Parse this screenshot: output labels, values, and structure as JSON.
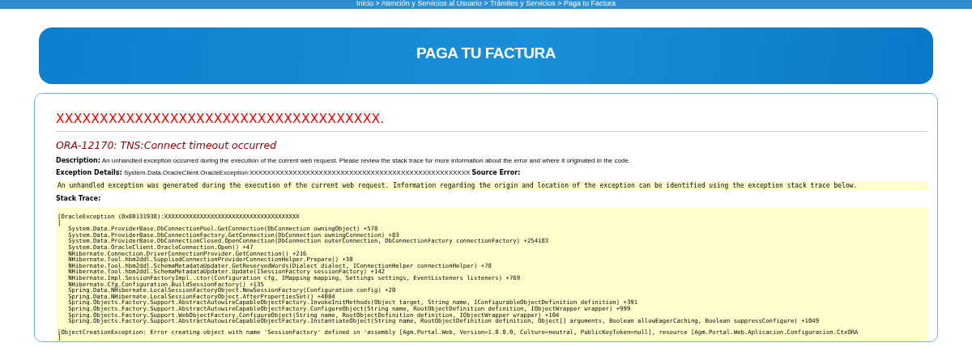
{
  "breadcrumb": "Inicio > Atención y Servicios al Usuario > Trámites y Servicios > Paga tu Factura",
  "banner": {
    "title": "PAGA TU FACTURA"
  },
  "error": {
    "heading": "XXXXXXXXXXXXXXXXXXXXXXXXXXXXXXXXXXXXX.",
    "subheading": "ORA-12170: TNS:Connect timeout occurred",
    "description": "**Description:** An unhandled exception occurred during the execution of the current web request. Please review the stack trace for more information about the error and where it originated in the code.",
    "exception_details": "**Exception Details:** System.Data.OracleClient.OracleException:XXXXXXXXXXXXXXXXXXXXXXXXXXXXXXXXXXXXXXXXXXXXXXXXXXX **Source Error:**",
    "source_error": "An unhandled exception was generated during the execution of the current web request. Information regarding the origin and location of the exception can be identified using the exception stack trace below.",
    "stack_trace_label": "Stack Trace:",
    "stack_trace": [
      {
        "lines": [
          "[OracleException (0x80131938):XXXXXXXXXXXXXXXXXXXXXXXXXXXXXXXXXXXXXX",
          "]",
          "   System.Data.ProviderBase.DbConnectionPool.GetConnection(DbConnection owningObject) +578",
          "   System.Data.ProviderBase.DbConnectionFactory.GetConnection(DbConnection owningConnection) +83",
          "   System.Data.ProviderBase.DbConnectionClosed.OpenConnection(DbConnection outerConnection, DbConnectionFactory connectionFactory) +254183",
          "   System.Data.OracleClient.OracleConnection.Open() +47",
          "   NHibernate.Connection.DriverConnectionProvider.GetConnection() +216",
          "   NHibernate.Tool.hbm2ddl.SuppliedConnectionProviderConnectionHelper.Prepare() +30",
          "   NHibernate.Tool.hbm2ddl.SchemaMetadataUpdater.GetReservedWords(Dialect dialect, IConnectionHelper connectionHelper) +78",
          "   NHibernate.Tool.hbm2ddl.SchemaMetadataUpdater.Update(ISessionFactory sessionFactory) +142",
          "   NHibernate.Impl.SessionFactoryImpl..ctor(Configuration cfg, IMapping mapping, Settings settings, EventListeners listeners) +769",
          "   NHibernate.Cfg.Configuration.BuildSessionFactory() +135",
          "   Spring.Data.NHibernate.LocalSessionFactoryObject.NewSessionFactory(Configuration config) +20",
          "   Spring.Data.NHibernate.LocalSessionFactoryObject.AfterPropertiesSet() +4084",
          "   Spring.Objects.Factory.Support.AbstractAutowireCapableObjectFactory.InvokeInitMethods(Object target, String name, IConfigurableObjectDefinition definition) +391",
          "   Spring.Objects.Factory.Support.AbstractAutowireCapableObjectFactory.ConfigureObject(String name, RootObjectDefinition definition, IObjectWrapper wrapper) +999",
          "   Spring.Objects.Factory.Support.WebObjectFactory.ConfigureObject(String name, RootObjectDefinition definition, IObjectWrapper wrapper) +104",
          "   Spring.Objects.Factory.Support.AbstractAutowireCapableObjectFactory.InstantiateObject(String name, RootObjectDefinition definition, Object[] arguments, Boolean allowEagerCaching, Boolean suppressConfigure) +1049"
        ]
      },
      {
        "lines": [
          "[ObjectCreationException: Error creating object with name 'SessionFactory' defined in 'assembly [Agm.Portal.Web, Version=1.0.0.0, Culture=neutral, PublicKeyToken=null], resource [Agm.Portal.Web.Aplicacion.Configuracion.CtxORA",
          "]"
        ]
      }
    ]
  }
}
